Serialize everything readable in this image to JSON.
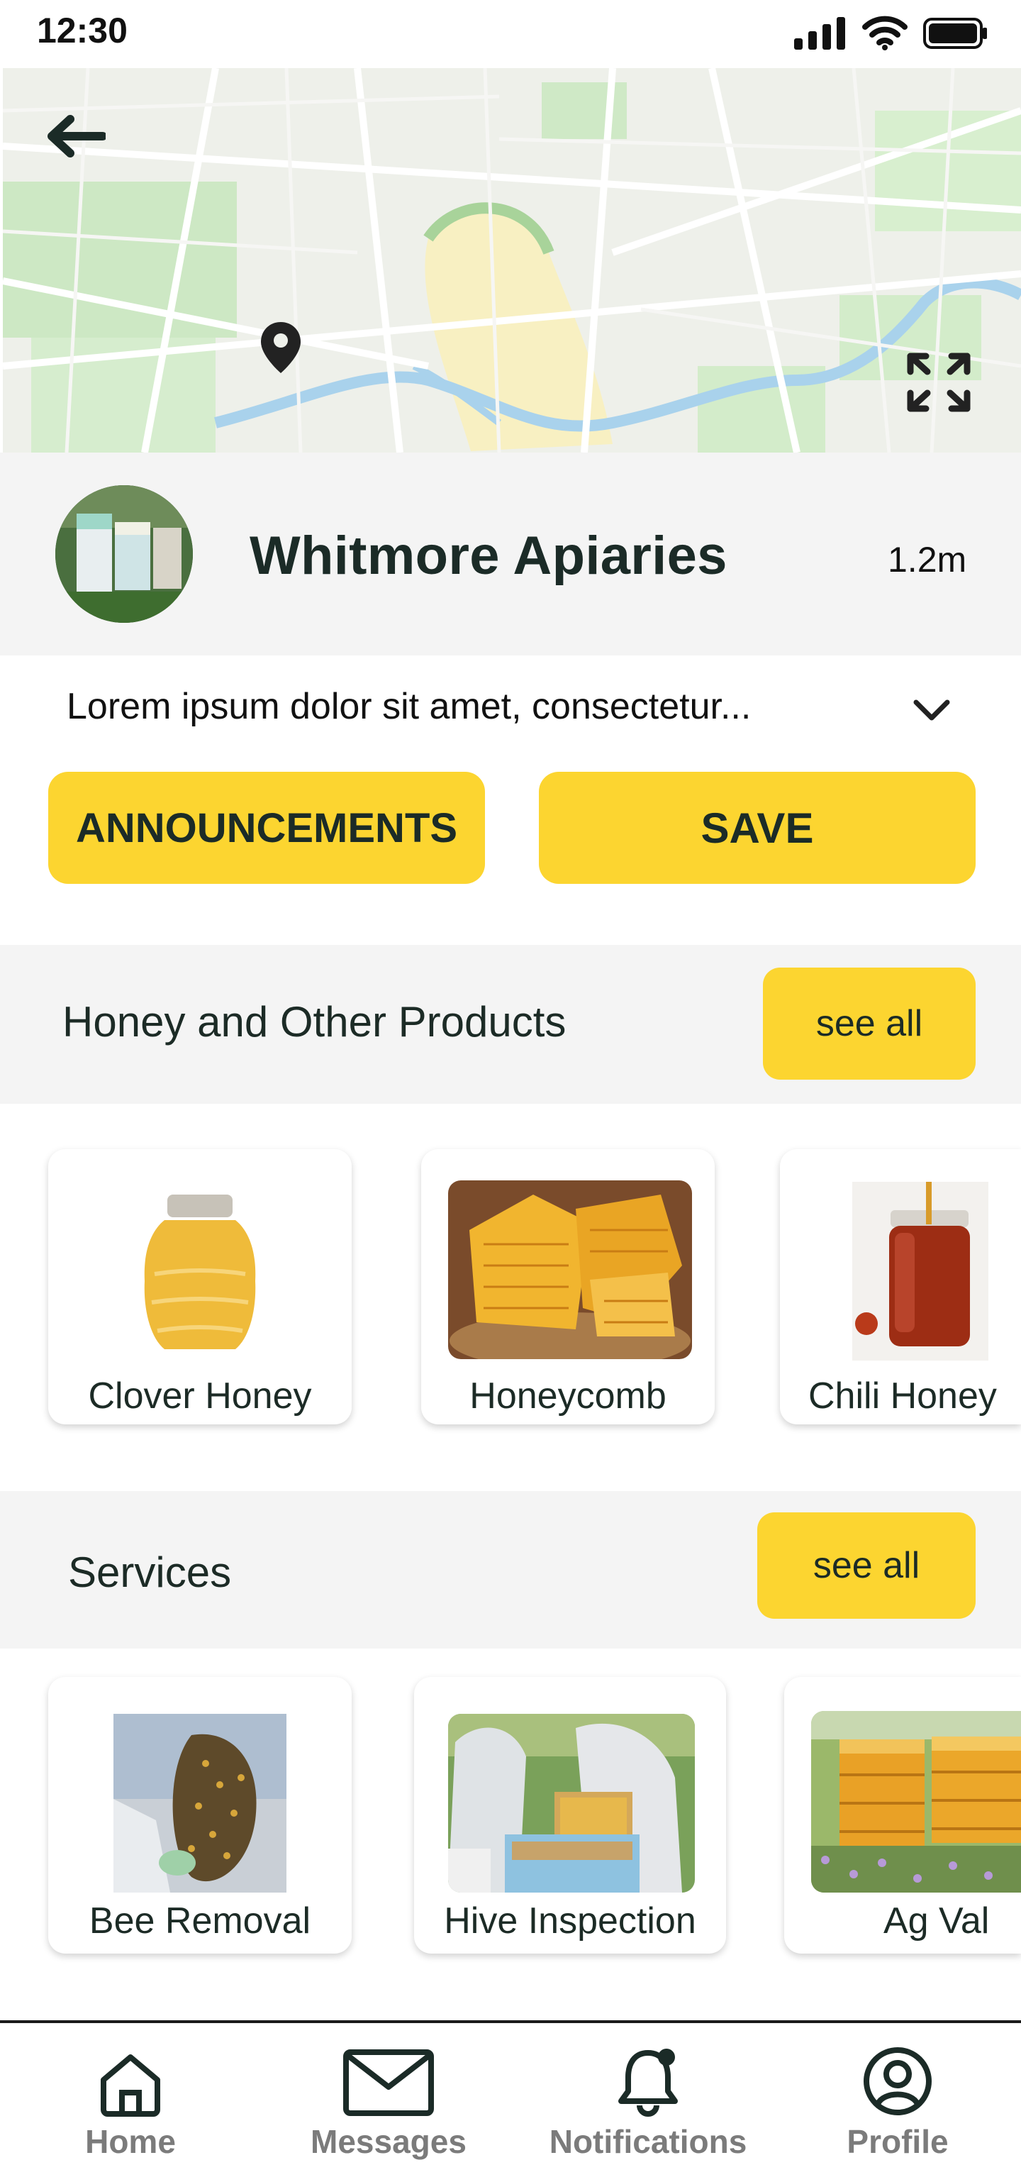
{
  "status_bar": {
    "time": "12:30"
  },
  "business": {
    "name": "Whitmore Apiaries",
    "distance": "1.2m",
    "description": "Lorem ipsum dolor sit amet, consectetur..."
  },
  "actions": {
    "announcements_label": "ANNOUNCEMENTS",
    "save_label": "SAVE"
  },
  "products": {
    "title": "Honey and Other Products",
    "see_all_label": "see all",
    "items": [
      {
        "label": "Clover Honey"
      },
      {
        "label": "Honeycomb"
      },
      {
        "label": "Chili Honey"
      }
    ]
  },
  "services": {
    "title": "Services",
    "see_all_label": "see all",
    "items": [
      {
        "label": "Bee Removal"
      },
      {
        "label": "Hive Inspection"
      },
      {
        "label": "Ag Val"
      }
    ]
  },
  "nav": {
    "items": [
      {
        "label": "Home",
        "icon": "home-icon"
      },
      {
        "label": "Messages",
        "icon": "mail-icon"
      },
      {
        "label": "Notifications",
        "icon": "bell-icon"
      },
      {
        "label": "Profile",
        "icon": "user-icon"
      }
    ]
  },
  "colors": {
    "accent": "#fcd530",
    "text_dark": "#1b2b27",
    "band_bg": "#f4f4f4",
    "nav_label": "#7b7b7b"
  }
}
